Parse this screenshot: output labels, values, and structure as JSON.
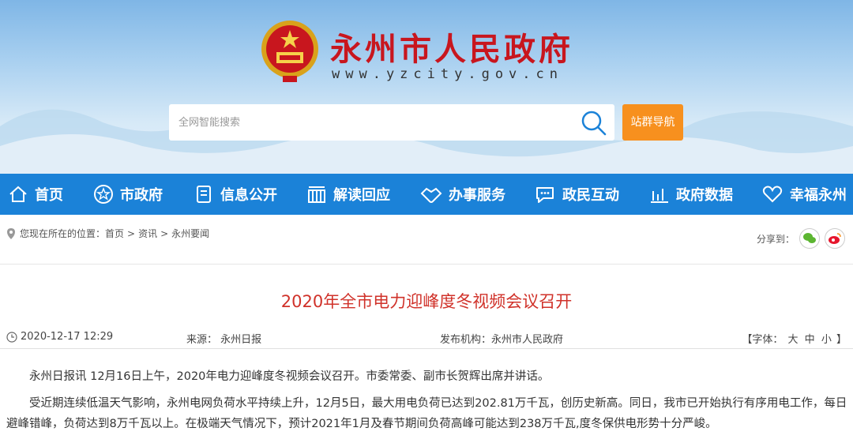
{
  "header": {
    "site_title": "永州市人民政府",
    "site_url": "www.yzcity.gov.cn",
    "search_placeholder": "全网智能搜索",
    "nav_guide_label": "站群导航"
  },
  "nav": {
    "items": [
      {
        "label": "首页",
        "icon": "home-icon"
      },
      {
        "label": "市政府",
        "icon": "star-icon"
      },
      {
        "label": "信息公开",
        "icon": "document-icon"
      },
      {
        "label": "解读回应",
        "icon": "building-icon"
      },
      {
        "label": "办事服务",
        "icon": "handshake-icon"
      },
      {
        "label": "政民互动",
        "icon": "chat-icon"
      },
      {
        "label": "政府数据",
        "icon": "bar-chart-icon"
      },
      {
        "label": "幸福永州",
        "icon": "heart-icon"
      }
    ]
  },
  "breadcrumb": {
    "prefix": "您现在所在的位置：",
    "items": [
      "首页",
      "资讯",
      "永州要闻"
    ],
    "separator": ">"
  },
  "share": {
    "label": "分享到：",
    "icons": [
      "wechat-icon",
      "weibo-icon"
    ]
  },
  "article": {
    "title": "2020年全市电力迎峰度冬视频会议召开",
    "date": "2020-12-17 12:29",
    "source": "来源： 永州日报",
    "publisher": "发布机构：永州市人民政府",
    "font_size_prefix": "【字体：",
    "font_sizes": [
      "大",
      "中",
      "小"
    ],
    "font_size_suffix": "】",
    "paragraphs": [
      "永州日报讯 12月16日上午，2020年电力迎峰度冬视频会议召开。市委常委、副市长贺辉出席并讲话。",
      "受近期连续低温天气影响，永州电网负荷水平持续上升，12月5日，最大用电负荷已达到202.81万千瓦，创历史新高。同日，我市已开始执行有序用电工作，每日避峰错峰，负荷达到8万千瓦以上。在极端天气情况下，预计2021年1月及春节期间负荷高峰可能达到238万千瓦,度冬保供电形势十分严峻。"
    ]
  },
  "colors": {
    "nav_bg": "#1b82d8",
    "title_red": "#c8161e",
    "article_title": "#d0322a",
    "guide_orange": "#f7901e"
  }
}
